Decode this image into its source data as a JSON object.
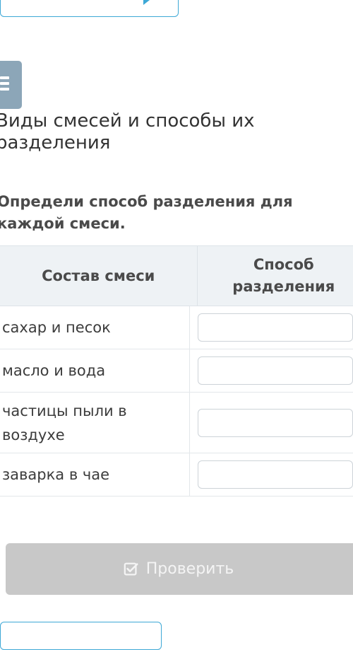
{
  "lesson": {
    "title": "Виды смесей и способы их разделения"
  },
  "task": {
    "instruction": "Определи способ разделения для каждой смеси."
  },
  "table": {
    "headers": [
      "Состав смеси",
      "Способ разделения"
    ],
    "rows": [
      {
        "mixture": "сахар и песок",
        "answer": ""
      },
      {
        "mixture": "масло и вода",
        "answer": ""
      },
      {
        "mixture": "частицы пыли в воздухе",
        "answer": ""
      },
      {
        "mixture": "заварка в чае",
        "answer": ""
      }
    ]
  },
  "actions": {
    "check_label": "Проверить",
    "check_icon": "checkbox-check-icon"
  },
  "colors": {
    "accent": "#3da8d6",
    "menu_badge": "#8ca6b8",
    "disabled_button": "#c8c8c8"
  }
}
